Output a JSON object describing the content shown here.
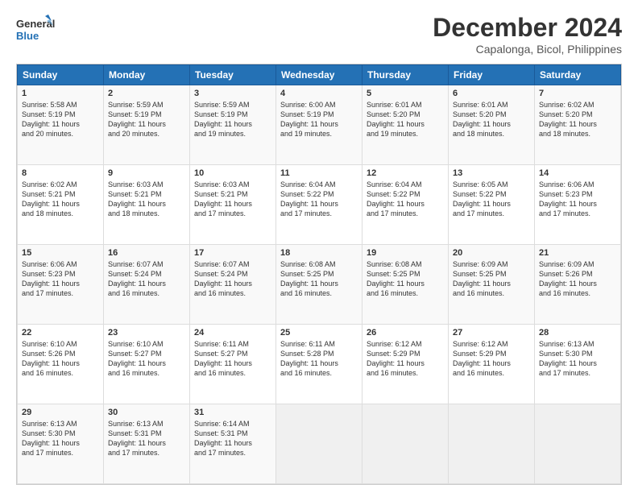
{
  "logo": {
    "line1": "General",
    "line2": "Blue"
  },
  "header": {
    "month_year": "December 2024",
    "location": "Capalonga, Bicol, Philippines"
  },
  "days_of_week": [
    "Sunday",
    "Monday",
    "Tuesday",
    "Wednesday",
    "Thursday",
    "Friday",
    "Saturday"
  ],
  "weeks": [
    [
      {
        "day": "1",
        "info": "Sunrise: 5:58 AM\nSunset: 5:19 PM\nDaylight: 11 hours\nand 20 minutes."
      },
      {
        "day": "2",
        "info": "Sunrise: 5:59 AM\nSunset: 5:19 PM\nDaylight: 11 hours\nand 20 minutes."
      },
      {
        "day": "3",
        "info": "Sunrise: 5:59 AM\nSunset: 5:19 PM\nDaylight: 11 hours\nand 19 minutes."
      },
      {
        "day": "4",
        "info": "Sunrise: 6:00 AM\nSunset: 5:19 PM\nDaylight: 11 hours\nand 19 minutes."
      },
      {
        "day": "5",
        "info": "Sunrise: 6:01 AM\nSunset: 5:20 PM\nDaylight: 11 hours\nand 19 minutes."
      },
      {
        "day": "6",
        "info": "Sunrise: 6:01 AM\nSunset: 5:20 PM\nDaylight: 11 hours\nand 18 minutes."
      },
      {
        "day": "7",
        "info": "Sunrise: 6:02 AM\nSunset: 5:20 PM\nDaylight: 11 hours\nand 18 minutes."
      }
    ],
    [
      {
        "day": "8",
        "info": "Sunrise: 6:02 AM\nSunset: 5:21 PM\nDaylight: 11 hours\nand 18 minutes."
      },
      {
        "day": "9",
        "info": "Sunrise: 6:03 AM\nSunset: 5:21 PM\nDaylight: 11 hours\nand 18 minutes."
      },
      {
        "day": "10",
        "info": "Sunrise: 6:03 AM\nSunset: 5:21 PM\nDaylight: 11 hours\nand 17 minutes."
      },
      {
        "day": "11",
        "info": "Sunrise: 6:04 AM\nSunset: 5:22 PM\nDaylight: 11 hours\nand 17 minutes."
      },
      {
        "day": "12",
        "info": "Sunrise: 6:04 AM\nSunset: 5:22 PM\nDaylight: 11 hours\nand 17 minutes."
      },
      {
        "day": "13",
        "info": "Sunrise: 6:05 AM\nSunset: 5:22 PM\nDaylight: 11 hours\nand 17 minutes."
      },
      {
        "day": "14",
        "info": "Sunrise: 6:06 AM\nSunset: 5:23 PM\nDaylight: 11 hours\nand 17 minutes."
      }
    ],
    [
      {
        "day": "15",
        "info": "Sunrise: 6:06 AM\nSunset: 5:23 PM\nDaylight: 11 hours\nand 17 minutes."
      },
      {
        "day": "16",
        "info": "Sunrise: 6:07 AM\nSunset: 5:24 PM\nDaylight: 11 hours\nand 16 minutes."
      },
      {
        "day": "17",
        "info": "Sunrise: 6:07 AM\nSunset: 5:24 PM\nDaylight: 11 hours\nand 16 minutes."
      },
      {
        "day": "18",
        "info": "Sunrise: 6:08 AM\nSunset: 5:25 PM\nDaylight: 11 hours\nand 16 minutes."
      },
      {
        "day": "19",
        "info": "Sunrise: 6:08 AM\nSunset: 5:25 PM\nDaylight: 11 hours\nand 16 minutes."
      },
      {
        "day": "20",
        "info": "Sunrise: 6:09 AM\nSunset: 5:25 PM\nDaylight: 11 hours\nand 16 minutes."
      },
      {
        "day": "21",
        "info": "Sunrise: 6:09 AM\nSunset: 5:26 PM\nDaylight: 11 hours\nand 16 minutes."
      }
    ],
    [
      {
        "day": "22",
        "info": "Sunrise: 6:10 AM\nSunset: 5:26 PM\nDaylight: 11 hours\nand 16 minutes."
      },
      {
        "day": "23",
        "info": "Sunrise: 6:10 AM\nSunset: 5:27 PM\nDaylight: 11 hours\nand 16 minutes."
      },
      {
        "day": "24",
        "info": "Sunrise: 6:11 AM\nSunset: 5:27 PM\nDaylight: 11 hours\nand 16 minutes."
      },
      {
        "day": "25",
        "info": "Sunrise: 6:11 AM\nSunset: 5:28 PM\nDaylight: 11 hours\nand 16 minutes."
      },
      {
        "day": "26",
        "info": "Sunrise: 6:12 AM\nSunset: 5:29 PM\nDaylight: 11 hours\nand 16 minutes."
      },
      {
        "day": "27",
        "info": "Sunrise: 6:12 AM\nSunset: 5:29 PM\nDaylight: 11 hours\nand 16 minutes."
      },
      {
        "day": "28",
        "info": "Sunrise: 6:13 AM\nSunset: 5:30 PM\nDaylight: 11 hours\nand 17 minutes."
      }
    ],
    [
      {
        "day": "29",
        "info": "Sunrise: 6:13 AM\nSunset: 5:30 PM\nDaylight: 11 hours\nand 17 minutes."
      },
      {
        "day": "30",
        "info": "Sunrise: 6:13 AM\nSunset: 5:31 PM\nDaylight: 11 hours\nand 17 minutes."
      },
      {
        "day": "31",
        "info": "Sunrise: 6:14 AM\nSunset: 5:31 PM\nDaylight: 11 hours\nand 17 minutes."
      },
      {
        "day": "",
        "info": ""
      },
      {
        "day": "",
        "info": ""
      },
      {
        "day": "",
        "info": ""
      },
      {
        "day": "",
        "info": ""
      }
    ]
  ]
}
